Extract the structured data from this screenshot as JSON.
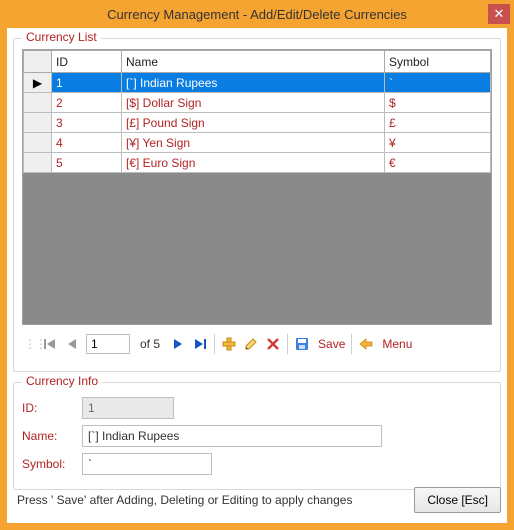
{
  "window": {
    "title": "Currency Management - Add/Edit/Delete Currencies"
  },
  "list_group": {
    "legend": "Currency List",
    "columns": {
      "id": "ID",
      "name": "Name",
      "symbol": "Symbol"
    },
    "rows": [
      {
        "id": "1",
        "name": "[`] Indian Rupees",
        "symbol": "`"
      },
      {
        "id": "2",
        "name": "[$] Dollar Sign",
        "symbol": "$"
      },
      {
        "id": "3",
        "name": "[£] Pound Sign",
        "symbol": "£"
      },
      {
        "id": "4",
        "name": "[¥] Yen Sign",
        "symbol": "¥"
      },
      {
        "id": "5",
        "name": "[€] Euro Sign",
        "symbol": "€"
      }
    ],
    "selected_index": 0
  },
  "nav": {
    "position": "1",
    "of_text": "of 5",
    "save_label": "Save",
    "menu_label": "Menu"
  },
  "info_group": {
    "legend": "Currency Info",
    "id_label": "ID:",
    "name_label": "Name:",
    "symbol_label": "Symbol:",
    "id_value": "1",
    "name_value": "[`] Indian Rupees",
    "symbol_value": "`"
  },
  "footer": {
    "hint": "Press '     Save' after Adding, Deleting or Editing to apply changes",
    "close_label": "Close [Esc]"
  },
  "colors": {
    "accent": "#f5a431",
    "text_accent": "#b22222",
    "selection": "#0a7de3"
  }
}
